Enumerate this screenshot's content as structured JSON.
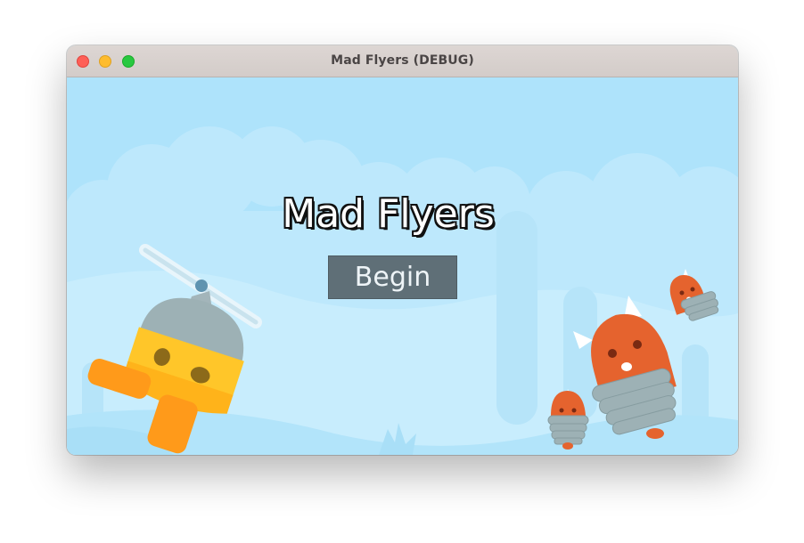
{
  "window": {
    "title": "Mad Flyers (DEBUG)",
    "controls": [
      "close",
      "minimize",
      "zoom"
    ]
  },
  "game": {
    "title": "Mad Flyers",
    "begin_label": "Begin"
  },
  "colors": {
    "sky": "#aee3fb",
    "button": "#5f6f77",
    "player_body": "#ffc629",
    "player_legs": "#ff9a1a",
    "enemy": "#e5632e",
    "enemy_spring": "#9db1b5"
  },
  "icons": {
    "player": "helicopter-robot-character",
    "enemies": [
      "spring-enemy-large",
      "spring-enemy-small-top",
      "spring-enemy-small-bottom"
    ]
  }
}
